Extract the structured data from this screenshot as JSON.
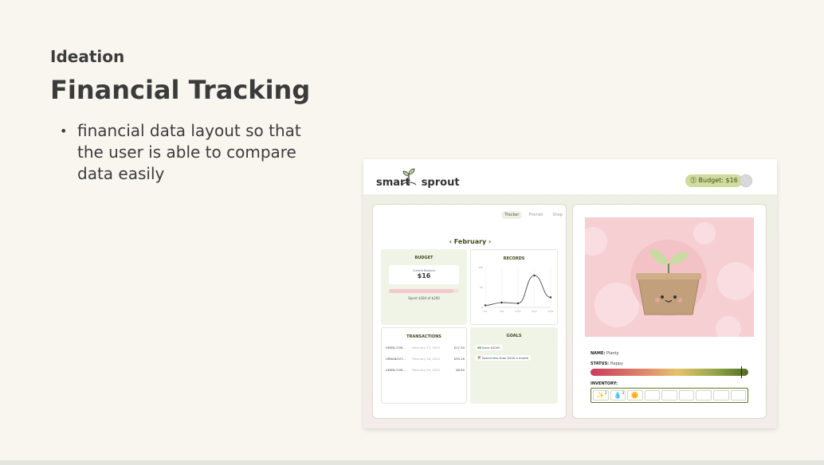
{
  "slide": {
    "eyebrow": "Ideation",
    "title": "Financial Tracking",
    "bullets": [
      "financial data layout so that the user is able to compare data easily"
    ]
  },
  "mockup": {
    "logo": {
      "left": "smart",
      "right": "sprout"
    },
    "budget_pill": "⓵ Budget: $16",
    "tabs": [
      "Tracker",
      "Friends",
      "Shop"
    ],
    "month": "‹  February  ›",
    "budget_card": {
      "title": "BUDGET",
      "balance_label": "Current Balance",
      "balance": "$16",
      "spent": "Spent $184 of $200",
      "spent_fraction": 0.92
    },
    "records_card": {
      "title": "RECORDS",
      "y_ticks": [
        "100",
        "50",
        "0"
      ],
      "x_ticks": [
        "2/1",
        "2/8",
        "2/15",
        "2/17",
        "2/19"
      ],
      "values": [
        5,
        12,
        10,
        80,
        25
      ]
    },
    "transactions_card": {
      "title": "TRANSACTIONS",
      "rows": [
        {
          "merchant": "AMZN.COM...",
          "date": "February 13, 2024",
          "amount": "$17.30"
        },
        {
          "merchant": "URBANOUT...",
          "date": "February 18, 2024",
          "amount": "$59.26"
        },
        {
          "merchant": "AMZN.COM...",
          "date": "February 26, 2024",
          "amount": "$8.90"
        }
      ]
    },
    "goals_card": {
      "title": "GOALS",
      "items": [
        "💵 Save $2000",
        "📅 Spend less than $200 a month"
      ]
    },
    "plant": {
      "name_label": "NAME:",
      "name": "Planty",
      "status_label": "STATUS:",
      "status": "Happy",
      "inventory_label": "INVENTORY:",
      "inventory": [
        {
          "icon": "✨",
          "count": "2"
        },
        {
          "icon": "💧",
          "count": "3"
        },
        {
          "icon": "🌼",
          "count": ""
        }
      ],
      "empty_slots": 6
    }
  }
}
